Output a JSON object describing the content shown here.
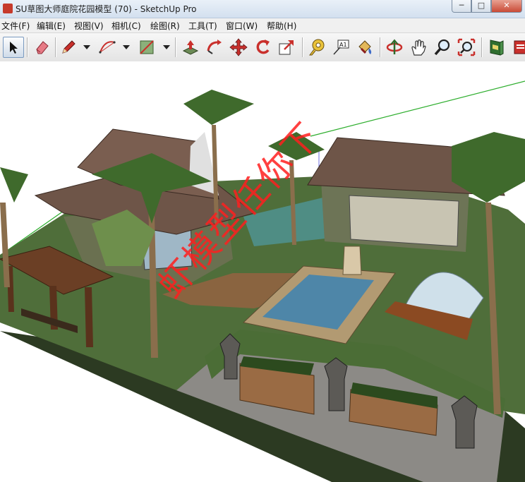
{
  "window": {
    "title": "SU草图大师庭院花园模型 (70) - SketchUp Pro",
    "minimize_label": "─",
    "maximize_label": "□",
    "close_label": "✕"
  },
  "menu": {
    "items": [
      {
        "label": "文件(F)"
      },
      {
        "label": "编辑(E)"
      },
      {
        "label": "视图(V)"
      },
      {
        "label": "相机(C)"
      },
      {
        "label": "绘图(R)"
      },
      {
        "label": "工具(T)"
      },
      {
        "label": "窗口(W)"
      },
      {
        "label": "帮助(H)"
      }
    ]
  },
  "toolbar": {
    "tools": [
      {
        "icon": "select-arrow-icon"
      },
      {
        "icon": "eraser-icon"
      },
      {
        "icon": "pencil-icon"
      },
      {
        "icon": "arc-icon"
      },
      {
        "icon": "rectangle-icon"
      },
      {
        "icon": "push-pull-icon"
      },
      {
        "icon": "follow-me-icon"
      },
      {
        "icon": "move-icon"
      },
      {
        "icon": "rotate-icon"
      },
      {
        "icon": "scale-icon"
      },
      {
        "icon": "tape-measure-icon"
      },
      {
        "icon": "text-icon"
      },
      {
        "icon": "paint-bucket-icon"
      },
      {
        "icon": "orbit-icon"
      },
      {
        "icon": "pan-hand-icon"
      },
      {
        "icon": "zoom-icon"
      },
      {
        "icon": "zoom-extents-icon"
      },
      {
        "icon": "warehouse-icon"
      },
      {
        "icon": "extension-icon"
      }
    ],
    "text_tool_label": "A1"
  },
  "viewport": {
    "watermark": "虾模型任你下",
    "colors": {
      "lawn": "#4f6e3a",
      "roof": "#6e5548",
      "water": "#4e86a8",
      "deck": "#8a6440",
      "axis_green": "#2eae2e"
    }
  }
}
